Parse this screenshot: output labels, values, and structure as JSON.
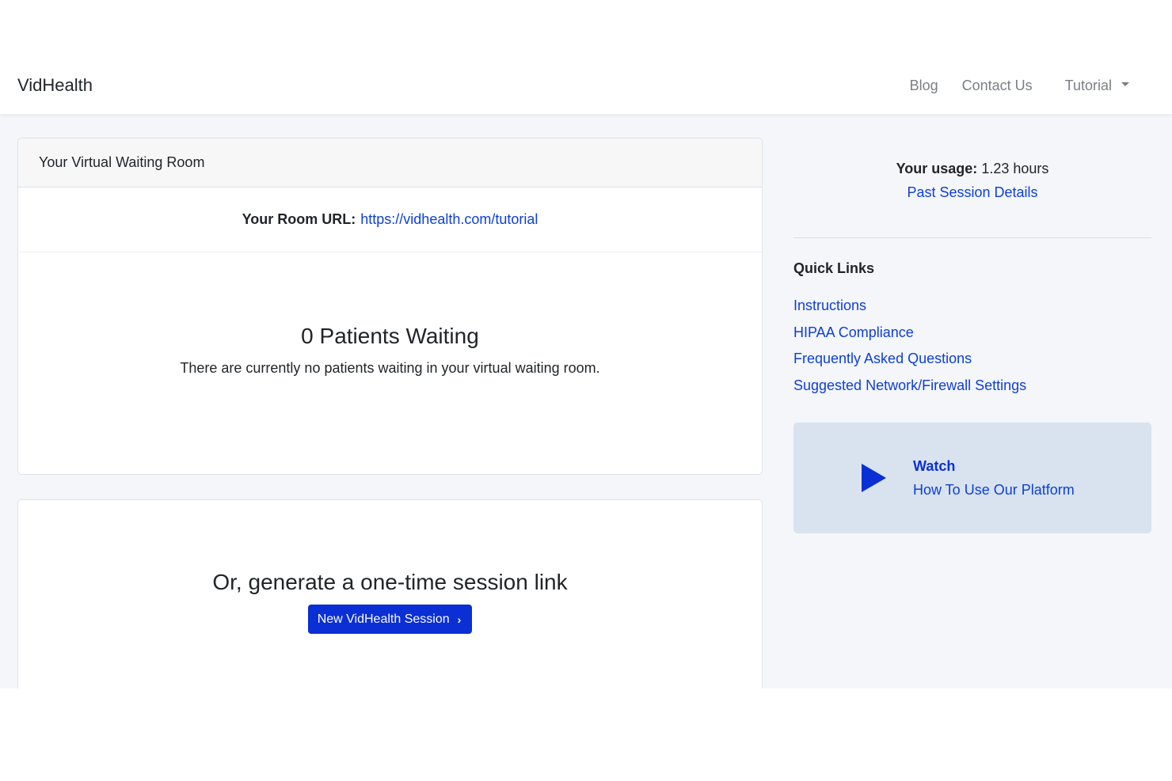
{
  "navbar": {
    "brand": "VidHealth",
    "links": [
      "Blog",
      "Contact Us"
    ],
    "dropdown_label": "Tutorial"
  },
  "waiting_room": {
    "header": "Your Virtual Waiting Room",
    "room_url_label": "Your Room URL:",
    "room_url": "https://vidhealth.com/tutorial",
    "patients_waiting": "0 Patients Waiting",
    "empty_message": "There are currently no patients waiting in your virtual waiting room."
  },
  "session": {
    "title": "Or, generate a one-time session link",
    "button_label": "New VidHealth Session",
    "button_chevron": "›"
  },
  "sidebar": {
    "usage_label": "Your usage:",
    "usage_value": "1.23 hours",
    "past_sessions_link": "Past Session Details",
    "quick_links_title": "Quick Links",
    "quick_links": [
      "Instructions",
      "HIPAA Compliance",
      "Frequently Asked Questions",
      "Suggested Network/Firewall Settings"
    ],
    "watch_title": "Watch",
    "watch_subtitle": "How To Use Our Platform"
  },
  "colors": {
    "link": "#0e3fd6",
    "primary": "#0a2fd4",
    "page_bg": "#f4f6f9",
    "watch_bg": "#d8e3ef"
  }
}
